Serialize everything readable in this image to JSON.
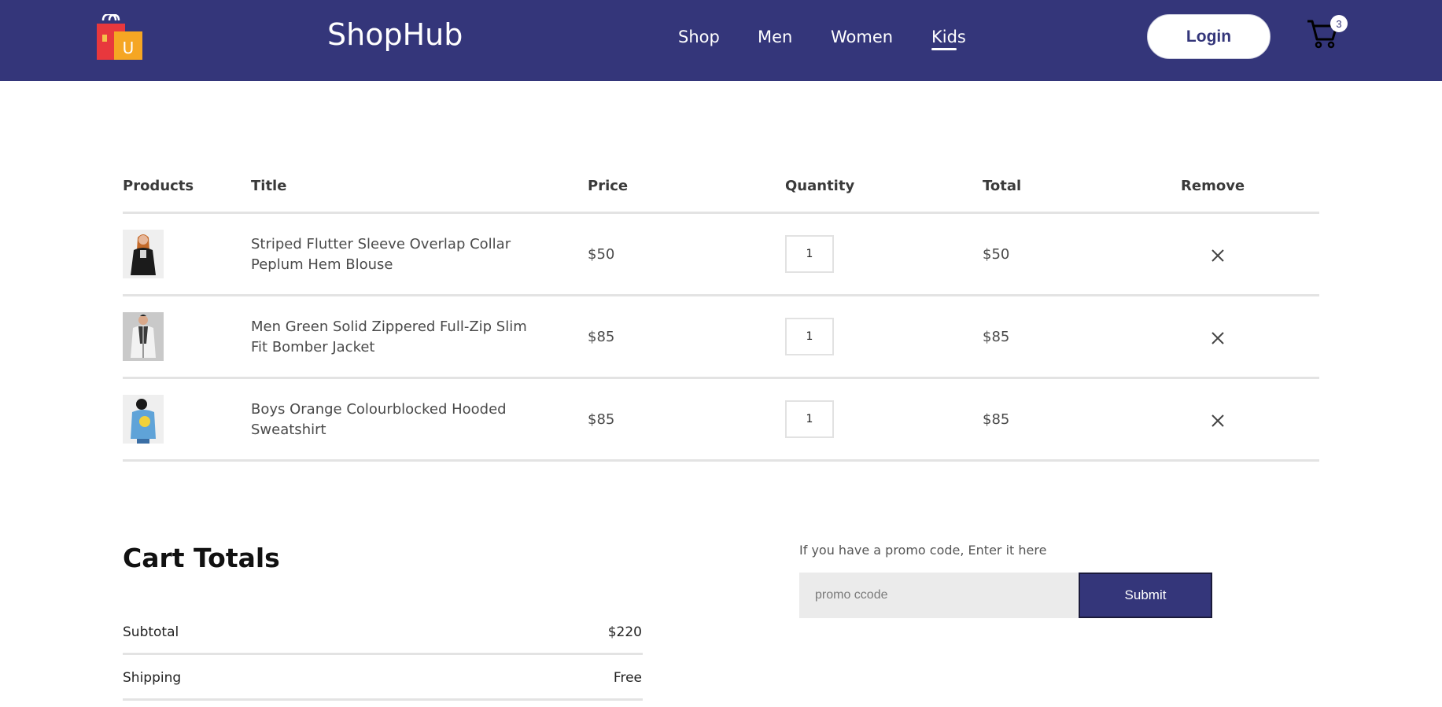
{
  "header": {
    "brand": "ShopHub",
    "logo_icon": "shopping-bag-logo-icon",
    "logo_letter": "U",
    "nav": [
      {
        "label": "Shop",
        "active": false
      },
      {
        "label": "Men",
        "active": false
      },
      {
        "label": "Women",
        "active": false
      },
      {
        "label": "Kids",
        "active": true
      }
    ],
    "login_label": "Login",
    "cart_count": "3",
    "colors": {
      "navbar": "#34367a",
      "logo_bag_red": "#e8383d",
      "logo_bag_orange": "#f5a623"
    }
  },
  "cart_table": {
    "headers": {
      "products": "Products",
      "title": "Title",
      "price": "Price",
      "quantity": "Quantity",
      "total": "Total",
      "remove": "Remove"
    },
    "rows": [
      {
        "title": "Striped Flutter Sleeve Overlap Collar Peplum Hem Blouse",
        "price": "$50",
        "quantity": "1",
        "total": "$50",
        "remove_icon": "close-icon"
      },
      {
        "title": "Men Green Solid Zippered Full-Zip Slim Fit Bomber Jacket",
        "price": "$85",
        "quantity": "1",
        "total": "$85",
        "remove_icon": "close-icon"
      },
      {
        "title": "Boys Orange Colourblocked Hooded Sweatshirt",
        "price": "$85",
        "quantity": "1",
        "total": "$85",
        "remove_icon": "close-icon"
      }
    ]
  },
  "cart_totals": {
    "title": "Cart Totals",
    "subtotal_label": "Subtotal",
    "subtotal_value": "$220",
    "shipping_label": "Shipping",
    "shipping_value": "Free"
  },
  "promo": {
    "label": "If you have a promo code, Enter it here",
    "placeholder": "promo ccode",
    "submit_label": "Submit"
  }
}
